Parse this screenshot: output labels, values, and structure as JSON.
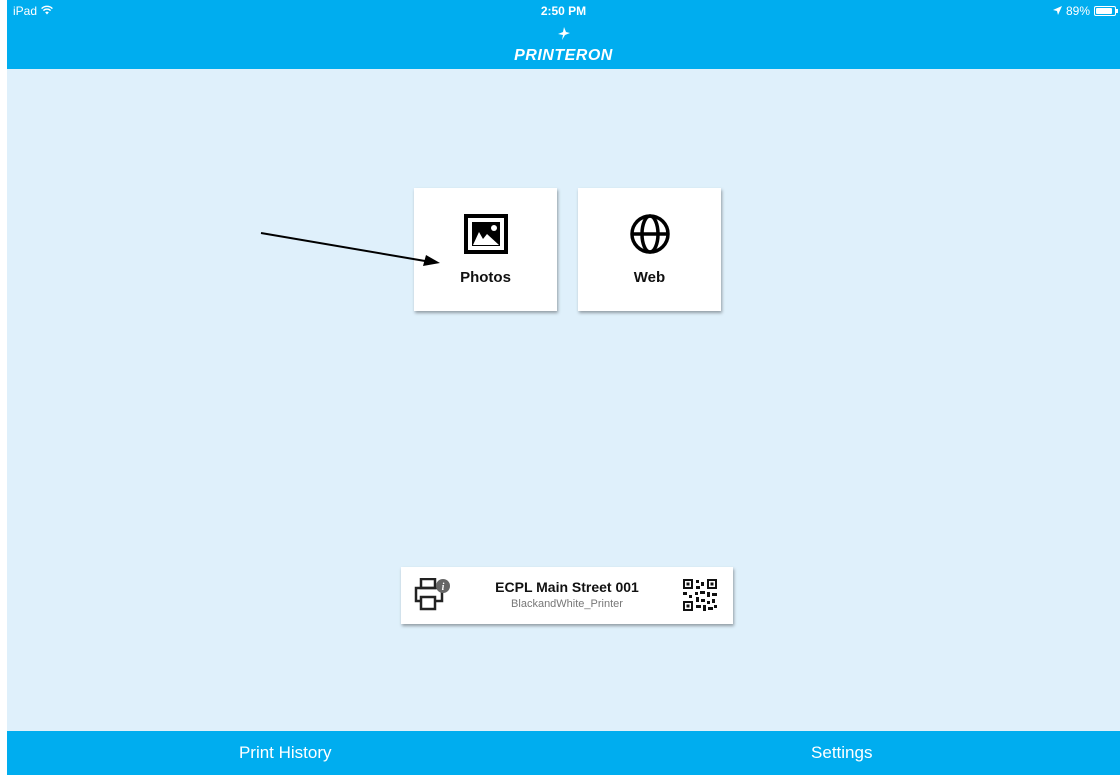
{
  "status_bar": {
    "device": "iPad",
    "wifi_icon": "wifi-icon",
    "time": "2:50 PM",
    "location_icon": "location-arrow-icon",
    "battery_text": "89%",
    "battery_level": 0.89
  },
  "nav_bar": {
    "logo_text": "PRINTERON",
    "logo_icon": "bird-icon"
  },
  "tiles": [
    {
      "label": "Photos",
      "icon": "photo-icon"
    },
    {
      "label": "Web",
      "icon": "globe-icon"
    }
  ],
  "printer": {
    "name": "ECPL Main Street 001",
    "queue": "BlackandWhite_Printer",
    "icon": "printer-info-icon",
    "qr_icon": "qr-code-icon"
  },
  "bottom_tabs": {
    "history_label": "Print History",
    "settings_label": "Settings"
  },
  "colors": {
    "accent": "#00adef",
    "background": "#dff0fb"
  }
}
